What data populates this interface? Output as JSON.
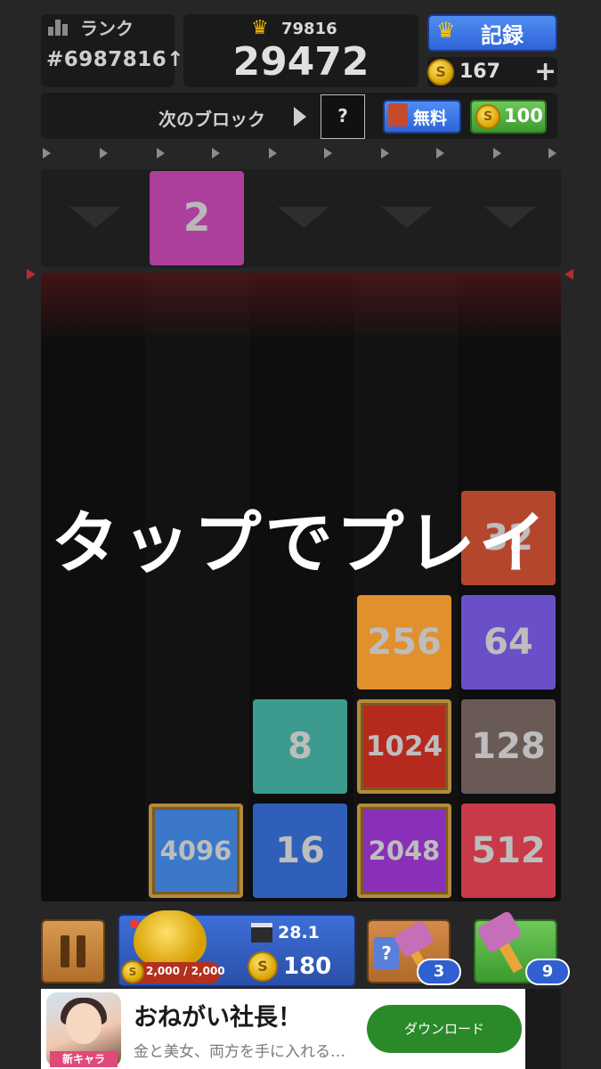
{
  "header": {
    "rank_label": "ランク",
    "rank_value": "#6987816↑",
    "best_score": "79816",
    "current_score": "29472",
    "record_label": "記録",
    "coins": "167",
    "add_coin": "+"
  },
  "next_block": {
    "label": "次のブロック",
    "preview": "?",
    "free_label": "無料",
    "coin_cost": "100"
  },
  "drop_tile": "2",
  "board": {
    "tiles": [
      {
        "value": "32",
        "color": "#b5462e"
      },
      {
        "value": "256",
        "color": "#e0902c"
      },
      {
        "value": "64",
        "color": "#6b4fc8"
      },
      {
        "value": "8",
        "color": "#3c9a8e"
      },
      {
        "value": "1024",
        "color": "#b52a1e"
      },
      {
        "value": "128",
        "color": "#6a5a55"
      },
      {
        "value": "4096",
        "color": "#3b78c9"
      },
      {
        "value": "16",
        "color": "#2f5fb8"
      },
      {
        "value": "2048",
        "color": "#8a2fb8"
      },
      {
        "value": "512",
        "color": "#c83a48"
      }
    ]
  },
  "overlay": "タップでプレイ",
  "piggy": {
    "progress": "2,000 / 2,000",
    "timer": "28.1",
    "amount": "180"
  },
  "items": {
    "mystery_count": "3",
    "mystery_symbol": "?",
    "hammer_count": "9"
  },
  "ad": {
    "title": "おねがい社長！",
    "subtitle": "金と美女、両方を手に入れる…",
    "badge": "新キャラ",
    "cta": "ダウンロード"
  }
}
